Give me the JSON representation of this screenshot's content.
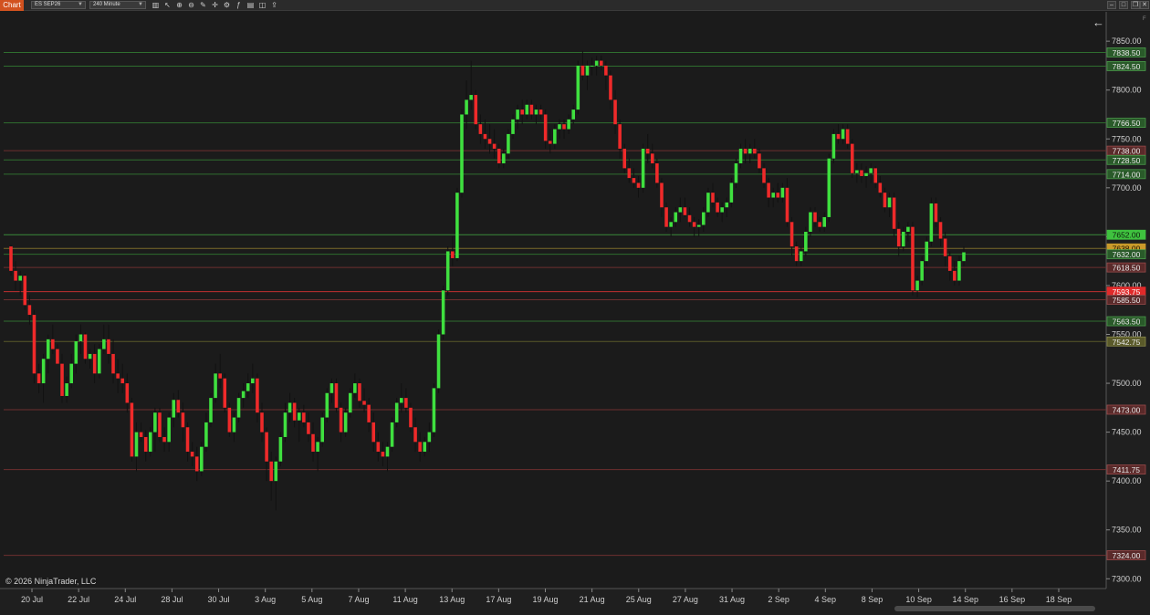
{
  "toolbar": {
    "tab_label": "Chart",
    "instrument": "ES SEP26",
    "interval": "240 Minute"
  },
  "copyright": "© 2026 NinjaTrader, LLC",
  "corner_label": "F",
  "colors": {
    "background": "#1b1b1b",
    "up": "#3fe03f",
    "down": "#ef2a2a",
    "accent": "#d2521f",
    "green_level": "#2f6e2f",
    "red_level": "#6e2f2f"
  },
  "chart_data": {
    "type": "candlestick",
    "ylim": [
      7290,
      7880
    ],
    "price_ticks": [
      "7850.00",
      "7800.00",
      "7750.00",
      "7700.00",
      "7650.00",
      "7600.00",
      "7550.00",
      "7500.00",
      "7450.00",
      "7400.00",
      "7350.00",
      "7300.00"
    ],
    "date_labels": [
      "20 Jul",
      "22 Jul",
      "24 Jul",
      "28 Jul",
      "30 Jul",
      "3 Aug",
      "5 Aug",
      "7 Aug",
      "11 Aug",
      "13 Aug",
      "17 Aug",
      "19 Aug",
      "21 Aug",
      "25 Aug",
      "27 Aug",
      "31 Aug",
      "2 Sep",
      "4 Sep",
      "8 Sep",
      "10 Sep",
      "14 Sep",
      "16 Sep",
      "18 Sep"
    ],
    "levels": [
      {
        "price": 7838.5,
        "label": "7838.50",
        "kind": "green"
      },
      {
        "price": 7824.5,
        "label": "7824.50",
        "kind": "green"
      },
      {
        "price": 7766.5,
        "label": "7766.50",
        "kind": "green"
      },
      {
        "price": 7738.0,
        "label": "7738.00",
        "kind": "red"
      },
      {
        "price": 7728.5,
        "label": "7728.50",
        "kind": "green"
      },
      {
        "price": 7714.0,
        "label": "7714.00",
        "kind": "green"
      },
      {
        "price": 7652.0,
        "label": "7652.00",
        "kind": "bright_green"
      },
      {
        "price": 7638.0,
        "label": "7638.00",
        "kind": "gold"
      },
      {
        "price": 7632.0,
        "label": "7632.00",
        "kind": "green"
      },
      {
        "price": 7618.5,
        "label": "7618.50",
        "kind": "red"
      },
      {
        "price": 7593.75,
        "label": "7593.75",
        "kind": "bright_red"
      },
      {
        "price": 7585.5,
        "label": "7585.50",
        "kind": "red"
      },
      {
        "price": 7563.5,
        "label": "7563.50",
        "kind": "green"
      },
      {
        "price": 7542.75,
        "label": "7542.75",
        "kind": "olive"
      },
      {
        "price": 7473.0,
        "label": "7473.00",
        "kind": "red"
      },
      {
        "price": 7411.75,
        "label": "7411.75",
        "kind": "red"
      },
      {
        "price": 7324.0,
        "label": "7324.00",
        "kind": "red"
      }
    ],
    "candles": [
      [
        7640,
        7642,
        7610,
        7615
      ],
      [
        7615,
        7625,
        7595,
        7605
      ],
      [
        7605,
        7615,
        7590,
        7610
      ],
      [
        7610,
        7612,
        7575,
        7580
      ],
      [
        7580,
        7590,
        7560,
        7570
      ],
      [
        7570,
        7575,
        7500,
        7510
      ],
      [
        7510,
        7520,
        7490,
        7500
      ],
      [
        7500,
        7530,
        7480,
        7525
      ],
      [
        7525,
        7550,
        7510,
        7545
      ],
      [
        7545,
        7560,
        7530,
        7535
      ],
      [
        7535,
        7540,
        7520,
        7520
      ],
      [
        7520,
        7530,
        7480,
        7487
      ],
      [
        7487,
        7507,
        7480,
        7500
      ],
      [
        7500,
        7530,
        7495,
        7520
      ],
      [
        7520,
        7550,
        7510,
        7543
      ],
      [
        7543,
        7560,
        7530,
        7550
      ],
      [
        7550,
        7552,
        7520,
        7525
      ],
      [
        7525,
        7535,
        7515,
        7530
      ],
      [
        7530,
        7540,
        7500,
        7510
      ],
      [
        7510,
        7540,
        7505,
        7535
      ],
      [
        7535,
        7560,
        7530,
        7545
      ],
      [
        7545,
        7560,
        7520,
        7530
      ],
      [
        7530,
        7545,
        7500,
        7510
      ],
      [
        7510,
        7525,
        7490,
        7505
      ],
      [
        7505,
        7520,
        7490,
        7500
      ],
      [
        7500,
        7510,
        7470,
        7480
      ],
      [
        7480,
        7485,
        7420,
        7425
      ],
      [
        7425,
        7460,
        7410,
        7450
      ],
      [
        7450,
        7460,
        7440,
        7445
      ],
      [
        7445,
        7452,
        7420,
        7430
      ],
      [
        7430,
        7455,
        7425,
        7450
      ],
      [
        7450,
        7475,
        7430,
        7470
      ],
      [
        7470,
        7475,
        7440,
        7445
      ],
      [
        7445,
        7455,
        7430,
        7440
      ],
      [
        7440,
        7470,
        7430,
        7465
      ],
      [
        7465,
        7490,
        7455,
        7483
      ],
      [
        7483,
        7493,
        7465,
        7470
      ],
      [
        7470,
        7480,
        7440,
        7455
      ],
      [
        7455,
        7460,
        7420,
        7430
      ],
      [
        7430,
        7440,
        7415,
        7425
      ],
      [
        7425,
        7435,
        7400,
        7410
      ],
      [
        7410,
        7440,
        7405,
        7435
      ],
      [
        7435,
        7470,
        7430,
        7460
      ],
      [
        7460,
        7490,
        7455,
        7485
      ],
      [
        7485,
        7520,
        7480,
        7510
      ],
      [
        7510,
        7530,
        7495,
        7505
      ],
      [
        7505,
        7510,
        7470,
        7475
      ],
      [
        7475,
        7480,
        7445,
        7450
      ],
      [
        7450,
        7470,
        7440,
        7465
      ],
      [
        7465,
        7490,
        7460,
        7485
      ],
      [
        7485,
        7500,
        7475,
        7492
      ],
      [
        7492,
        7510,
        7485,
        7500
      ],
      [
        7500,
        7520,
        7490,
        7505
      ],
      [
        7505,
        7510,
        7460,
        7470
      ],
      [
        7470,
        7480,
        7440,
        7450
      ],
      [
        7450,
        7455,
        7400,
        7420
      ],
      [
        7420,
        7430,
        7380,
        7400
      ],
      [
        7400,
        7425,
        7370,
        7420
      ],
      [
        7420,
        7450,
        7415,
        7445
      ],
      [
        7445,
        7480,
        7440,
        7470
      ],
      [
        7470,
        7490,
        7460,
        7480
      ],
      [
        7480,
        7485,
        7455,
        7462
      ],
      [
        7462,
        7475,
        7440,
        7470
      ],
      [
        7470,
        7478,
        7455,
        7460
      ],
      [
        7460,
        7470,
        7440,
        7448
      ],
      [
        7448,
        7460,
        7420,
        7430
      ],
      [
        7430,
        7445,
        7410,
        7440
      ],
      [
        7440,
        7470,
        7435,
        7465
      ],
      [
        7465,
        7495,
        7460,
        7490
      ],
      [
        7490,
        7505,
        7480,
        7500
      ],
      [
        7500,
        7505,
        7470,
        7475
      ],
      [
        7475,
        7480,
        7440,
        7450
      ],
      [
        7450,
        7475,
        7445,
        7470
      ],
      [
        7470,
        7495,
        7465,
        7490
      ],
      [
        7490,
        7510,
        7485,
        7500
      ],
      [
        7500,
        7505,
        7475,
        7482
      ],
      [
        7482,
        7495,
        7470,
        7478
      ],
      [
        7478,
        7485,
        7450,
        7460
      ],
      [
        7460,
        7470,
        7430,
        7440
      ],
      [
        7440,
        7450,
        7420,
        7430
      ],
      [
        7430,
        7440,
        7415,
        7425
      ],
      [
        7425,
        7440,
        7410,
        7435
      ],
      [
        7435,
        7465,
        7430,
        7460
      ],
      [
        7460,
        7485,
        7455,
        7480
      ],
      [
        7480,
        7500,
        7470,
        7485
      ],
      [
        7485,
        7495,
        7470,
        7475
      ],
      [
        7475,
        7480,
        7450,
        7455
      ],
      [
        7455,
        7465,
        7430,
        7440
      ],
      [
        7440,
        7450,
        7420,
        7430
      ],
      [
        7430,
        7445,
        7425,
        7440
      ],
      [
        7440,
        7460,
        7430,
        7450
      ],
      [
        7450,
        7500,
        7445,
        7495
      ],
      [
        7495,
        7555,
        7490,
        7550
      ],
      [
        7550,
        7600,
        7545,
        7595
      ],
      [
        7595,
        7640,
        7590,
        7635
      ],
      [
        7635,
        7650,
        7620,
        7628
      ],
      [
        7628,
        7700,
        7625,
        7695
      ],
      [
        7695,
        7780,
        7690,
        7775
      ],
      [
        7775,
        7810,
        7760,
        7790
      ],
      [
        7790,
        7830,
        7780,
        7795
      ],
      [
        7795,
        7800,
        7760,
        7765
      ],
      [
        7765,
        7775,
        7745,
        7755
      ],
      [
        7755,
        7770,
        7740,
        7750
      ],
      [
        7750,
        7765,
        7735,
        7745
      ],
      [
        7745,
        7760,
        7730,
        7740
      ],
      [
        7740,
        7745,
        7720,
        7725
      ],
      [
        7725,
        7740,
        7720,
        7735
      ],
      [
        7735,
        7760,
        7730,
        7755
      ],
      [
        7755,
        7775,
        7750,
        7770
      ],
      [
        7770,
        7785,
        7760,
        7780
      ],
      [
        7780,
        7790,
        7765,
        7775
      ],
      [
        7775,
        7790,
        7770,
        7785
      ],
      [
        7785,
        7790,
        7770,
        7775
      ],
      [
        7775,
        7785,
        7765,
        7780
      ],
      [
        7780,
        7785,
        7770,
        7775
      ],
      [
        7775,
        7780,
        7740,
        7748
      ],
      [
        7748,
        7760,
        7735,
        7745
      ],
      [
        7745,
        7765,
        7740,
        7760
      ],
      [
        7760,
        7770,
        7750,
        7765
      ],
      [
        7765,
        7770,
        7750,
        7760
      ],
      [
        7760,
        7775,
        7755,
        7770
      ],
      [
        7770,
        7785,
        7765,
        7780
      ],
      [
        7780,
        7830,
        7775,
        7825
      ],
      [
        7825,
        7840,
        7810,
        7815
      ],
      [
        7815,
        7830,
        7800,
        7825
      ],
      [
        7825,
        7833,
        7815,
        7825
      ],
      [
        7825,
        7835,
        7815,
        7830
      ],
      [
        7830,
        7835,
        7820,
        7825
      ],
      [
        7825,
        7830,
        7800,
        7815
      ],
      [
        7815,
        7820,
        7780,
        7790
      ],
      [
        7790,
        7800,
        7755,
        7765
      ],
      [
        7765,
        7770,
        7730,
        7740
      ],
      [
        7740,
        7745,
        7715,
        7720
      ],
      [
        7720,
        7730,
        7705,
        7710
      ],
      [
        7710,
        7720,
        7700,
        7705
      ],
      [
        7705,
        7712,
        7690,
        7700
      ],
      [
        7700,
        7745,
        7695,
        7740
      ],
      [
        7740,
        7755,
        7725,
        7735
      ],
      [
        7735,
        7745,
        7720,
        7725
      ],
      [
        7725,
        7730,
        7700,
        7705
      ],
      [
        7705,
        7710,
        7670,
        7680
      ],
      [
        7680,
        7685,
        7655,
        7660
      ],
      [
        7660,
        7670,
        7650,
        7665
      ],
      [
        7665,
        7680,
        7660,
        7675
      ],
      [
        7675,
        7690,
        7665,
        7680
      ],
      [
        7680,
        7690,
        7670,
        7672
      ],
      [
        7672,
        7680,
        7660,
        7665
      ],
      [
        7665,
        7670,
        7650,
        7660
      ],
      [
        7660,
        7668,
        7650,
        7662
      ],
      [
        7662,
        7680,
        7655,
        7675
      ],
      [
        7675,
        7700,
        7670,
        7695
      ],
      [
        7695,
        7705,
        7680,
        7685
      ],
      [
        7685,
        7690,
        7670,
        7675
      ],
      [
        7675,
        7685,
        7665,
        7680
      ],
      [
        7680,
        7690,
        7670,
        7685
      ],
      [
        7685,
        7710,
        7680,
        7705
      ],
      [
        7705,
        7730,
        7700,
        7725
      ],
      [
        7725,
        7745,
        7720,
        7740
      ],
      [
        7740,
        7750,
        7725,
        7735
      ],
      [
        7735,
        7745,
        7725,
        7740
      ],
      [
        7740,
        7750,
        7730,
        7735
      ],
      [
        7735,
        7740,
        7715,
        7720
      ],
      [
        7720,
        7725,
        7700,
        7705
      ],
      [
        7705,
        7710,
        7680,
        7690
      ],
      [
        7690,
        7700,
        7680,
        7695
      ],
      [
        7695,
        7705,
        7685,
        7690
      ],
      [
        7690,
        7705,
        7685,
        7700
      ],
      [
        7700,
        7710,
        7660,
        7665
      ],
      [
        7665,
        7670,
        7630,
        7640
      ],
      [
        7640,
        7645,
        7620,
        7625
      ],
      [
        7625,
        7640,
        7620,
        7635
      ],
      [
        7635,
        7660,
        7630,
        7655
      ],
      [
        7655,
        7680,
        7650,
        7675
      ],
      [
        7675,
        7680,
        7660,
        7665
      ],
      [
        7665,
        7670,
        7655,
        7660
      ],
      [
        7660,
        7675,
        7655,
        7670
      ],
      [
        7670,
        7735,
        7665,
        7730
      ],
      [
        7730,
        7760,
        7725,
        7755
      ],
      [
        7755,
        7765,
        7745,
        7750
      ],
      [
        7750,
        7765,
        7745,
        7760
      ],
      [
        7760,
        7765,
        7740,
        7745
      ],
      [
        7745,
        7750,
        7710,
        7715
      ],
      [
        7715,
        7725,
        7705,
        7718
      ],
      [
        7718,
        7725,
        7705,
        7712
      ],
      [
        7712,
        7722,
        7700,
        7715
      ],
      [
        7715,
        7725,
        7705,
        7720
      ],
      [
        7720,
        7722,
        7700,
        7705
      ],
      [
        7705,
        7712,
        7690,
        7695
      ],
      [
        7695,
        7700,
        7675,
        7680
      ],
      [
        7680,
        7695,
        7670,
        7690
      ],
      [
        7690,
        7695,
        7650,
        7658
      ],
      [
        7658,
        7665,
        7630,
        7640
      ],
      [
        7640,
        7660,
        7635,
        7655
      ],
      [
        7655,
        7665,
        7645,
        7660
      ],
      [
        7660,
        7665,
        7590,
        7595
      ],
      [
        7595,
        7610,
        7588,
        7605
      ],
      [
        7605,
        7630,
        7600,
        7625
      ],
      [
        7625,
        7650,
        7620,
        7645
      ],
      [
        7645,
        7690,
        7640,
        7684
      ],
      [
        7684,
        7690,
        7660,
        7665
      ],
      [
        7665,
        7670,
        7640,
        7648
      ],
      [
        7648,
        7655,
        7620,
        7630
      ],
      [
        7630,
        7635,
        7605,
        7615
      ],
      [
        7615,
        7625,
        7600,
        7605
      ],
      [
        7605,
        7630,
        7600,
        7625
      ],
      [
        7625,
        7640,
        7620,
        7634
      ]
    ]
  }
}
